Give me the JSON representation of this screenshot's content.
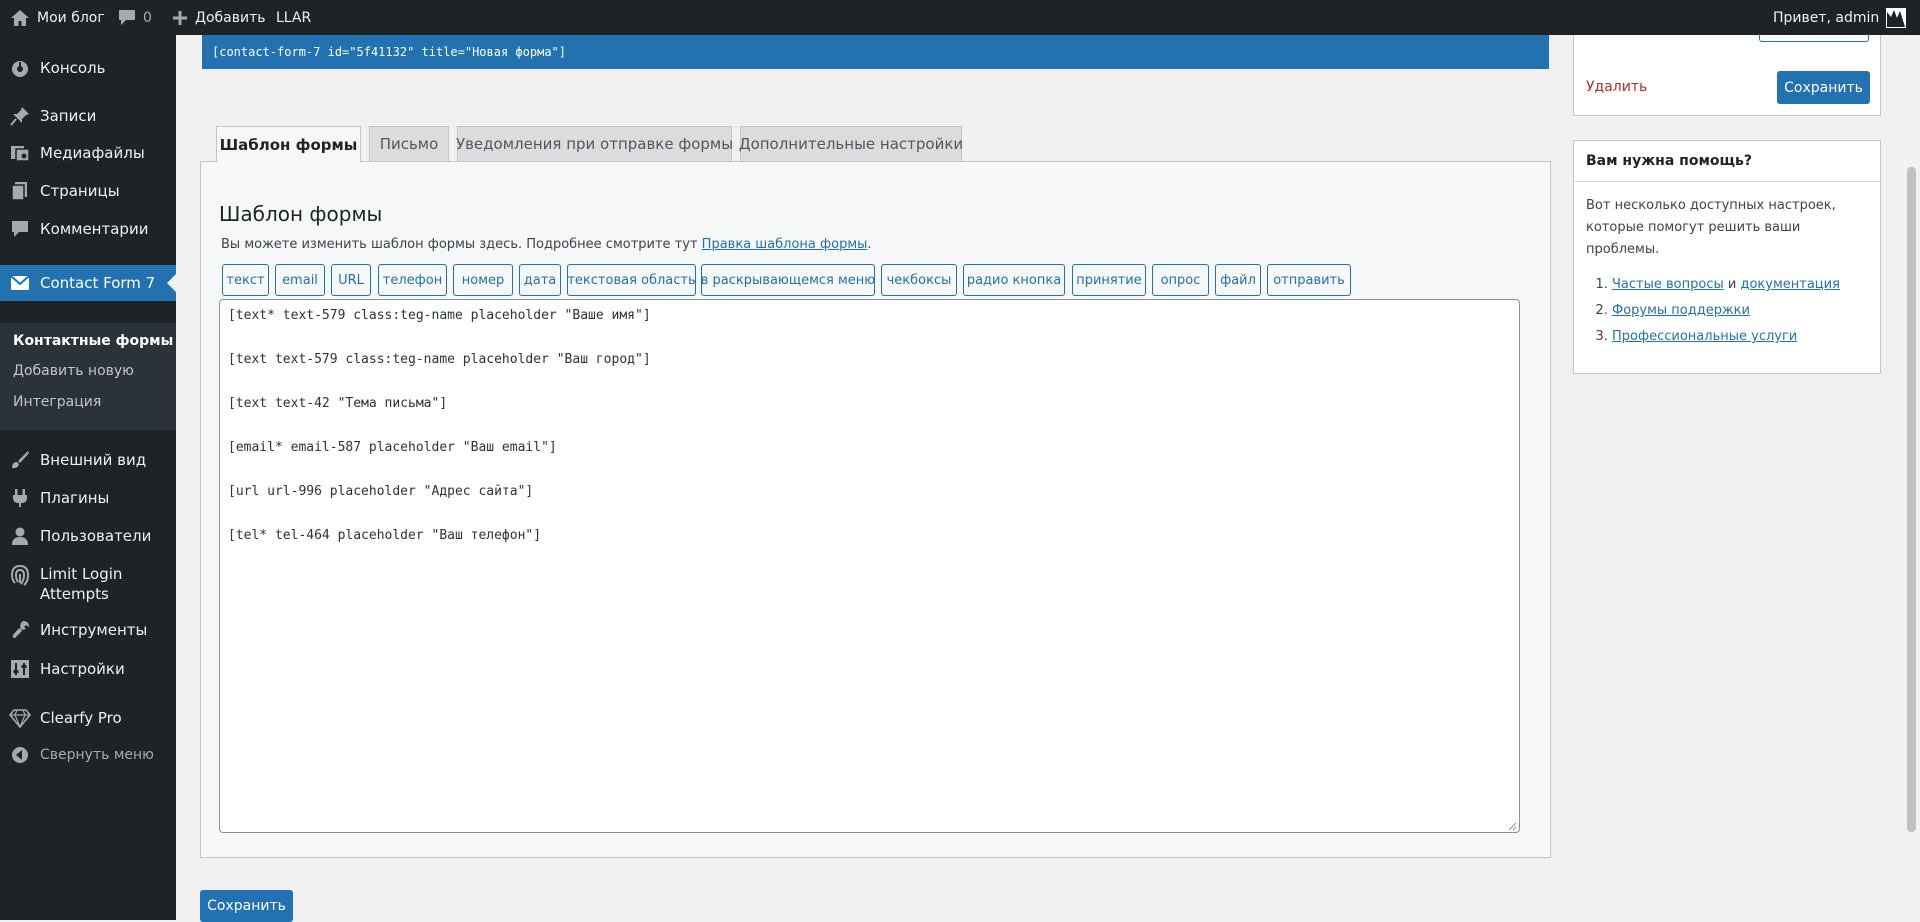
{
  "adminbar": {
    "site_name": "Мои блог",
    "comments_count": "0",
    "new_label": "Добавить",
    "plugin_label": "LLAR",
    "greeting": "Привет, admin"
  },
  "menu": {
    "console": "Консоль",
    "posts": "Записи",
    "media": "Медиафайлы",
    "pages": "Страницы",
    "comments": "Комментарии",
    "contact_form": "Contact Form 7",
    "submenu": [
      "Контактные формы",
      "Добавить новую",
      "Интеграция"
    ],
    "appearance": "Внешний вид",
    "plugins": "Плагины",
    "users": "Пользователи",
    "limit_login_line1": "Limit Login",
    "limit_login_line2": "Attempts",
    "tools": "Инструменты",
    "settings": "Настройки",
    "clearfy": "Clearfy Pro",
    "collapse": "Свернуть меню"
  },
  "shortcode": "[contact-form-7 id=\"5f41132\" title=\"Новая форма\"]",
  "tabs": [
    "Шаблон формы",
    "Письмо",
    "Уведомления при отправке формы",
    "Дополнительные настройки"
  ],
  "panel": {
    "title": "Шаблон формы",
    "description": "Вы можете изменить шаблон формы здесь. Подробнее смотрите тут ",
    "description_link": "Правка шаблона формы",
    "description_end": "."
  },
  "tag_buttons": [
    "текст",
    "email",
    "URL",
    "телефон",
    "номер",
    "дата",
    "текстовая область",
    "в раскрывающемся меню",
    "чекбоксы",
    "радио кнопка",
    "принятие",
    "опрос",
    "файл",
    "отправить"
  ],
  "form_lines": [
    "[text* text-579 class:teg-name placeholder \"Ваше имя\"]",
    "[text text-579 class:teg-name placeholder \"Ваш город\"]",
    "[text text-42 \"Тема письма\"]",
    "[email* email-587 placeholder \"Ваш email\"]",
    "[url url-996 placeholder \"Адрес сайта\"]",
    "[tel* tel-464 placeholder \"Ваш телефон\"]"
  ],
  "save_label": "Сохранить",
  "delete_label": "Удалить",
  "help": {
    "title": "Вам нужна помощь?",
    "text": "Вот несколько доступных настроек, которые помогут решить ваши проблемы.",
    "item1_link_a": "Частые вопросы",
    "item1_and": " и ",
    "item1_link_b": "документация",
    "item2_link": "Форумы поддержки",
    "item3_link": "Профессиональные услуги"
  },
  "colors": {
    "admin_dark": "#1d2327",
    "accent": "#2271b1",
    "delete_red": "#b32d2e"
  }
}
